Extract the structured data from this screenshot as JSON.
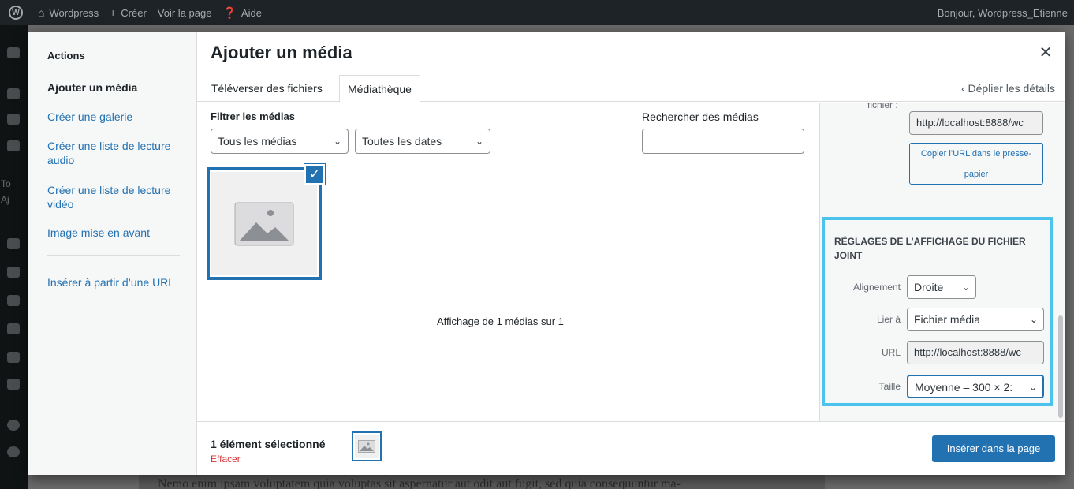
{
  "adminbar": {
    "site_name": "Wordpress",
    "new_label": "Créer",
    "view_page": "Voir la page",
    "help": "Aide",
    "greeting": "Bonjour, Wordpress_Etienne"
  },
  "background": {
    "text": "Nemo enim ipsam voluptatem quia voluptas sit aspernatur aut odit aut fugit, sed quia consequuntur ma-",
    "side_t1": "To",
    "side_t2": "Aj"
  },
  "menu": {
    "heading": "Actions",
    "items": [
      "Ajouter un média",
      "Créer une galerie",
      "Créer une liste de lecture audio",
      "Créer une liste de lecture vidéo",
      "Image mise en avant",
      "Insérer à partir d’une URL"
    ]
  },
  "modal": {
    "title": "Ajouter un média",
    "tabs": [
      "Téléverser des fichiers",
      "Médiathèque"
    ],
    "expand_details": "Déplier les détails"
  },
  "toolbar": {
    "filter_label": "Filtrer les médias",
    "type_filter": "Tous les médias",
    "date_filter": "Toutes les dates",
    "search_label": "Rechercher des médias",
    "search_value": ""
  },
  "library": {
    "count_text": "Affichage de 1 médias sur 1"
  },
  "details": {
    "fichier_label": "fichier :",
    "file_url": "http://localhost:8888/wc",
    "copy_button": "Copier l’URL dans le presse-papier"
  },
  "display_settings": {
    "heading": "RÉGLAGES DE L’AFFICHAGE DU FICHIER JOINT",
    "align_label": "Alignement",
    "align_value": "Droite",
    "link_label": "Lier à",
    "link_value": "Fichier média",
    "url_label": "URL",
    "url_value": "http://localhost:8888/wc",
    "size_label": "Taille",
    "size_value": "Moyenne – 300 × 2:"
  },
  "footer": {
    "selection_count": "1 élément sélectionné",
    "clear": "Effacer",
    "insert_button": "Insérer dans la page"
  },
  "colors": {
    "accent": "#2271b1",
    "highlight": "#4cc3ec",
    "danger": "#d63638"
  }
}
